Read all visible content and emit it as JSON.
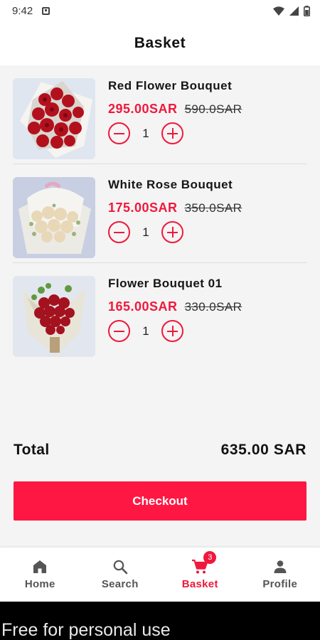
{
  "status_bar": {
    "time": "9:42"
  },
  "header": {
    "title": "Basket"
  },
  "cart": {
    "items": [
      {
        "name": "Red Flower Bouquet",
        "price": "295.00SAR",
        "old_price": "590.0SAR",
        "quantity": "1"
      },
      {
        "name": "White Rose Bouquet",
        "price": "175.00SAR",
        "old_price": "350.0SAR",
        "quantity": "1"
      },
      {
        "name": "Flower Bouquet 01",
        "price": "165.00SAR",
        "old_price": "330.0SAR",
        "quantity": "1"
      }
    ]
  },
  "summary": {
    "total_label": "Total",
    "total_value": "635.00 SAR"
  },
  "checkout": {
    "label": "Checkout"
  },
  "nav": {
    "items": [
      {
        "label": "Home",
        "icon": "home-icon",
        "active": false
      },
      {
        "label": "Search",
        "icon": "search-icon",
        "active": false
      },
      {
        "label": "Basket",
        "icon": "cart-icon",
        "active": true,
        "badge": "3"
      },
      {
        "label": "Profile",
        "icon": "person-icon",
        "active": false
      }
    ]
  },
  "watermark": {
    "text": "Free for personal use"
  },
  "colors": {
    "accent": "#f0183c",
    "button": "#ff1744",
    "background": "#f4f4f4"
  }
}
